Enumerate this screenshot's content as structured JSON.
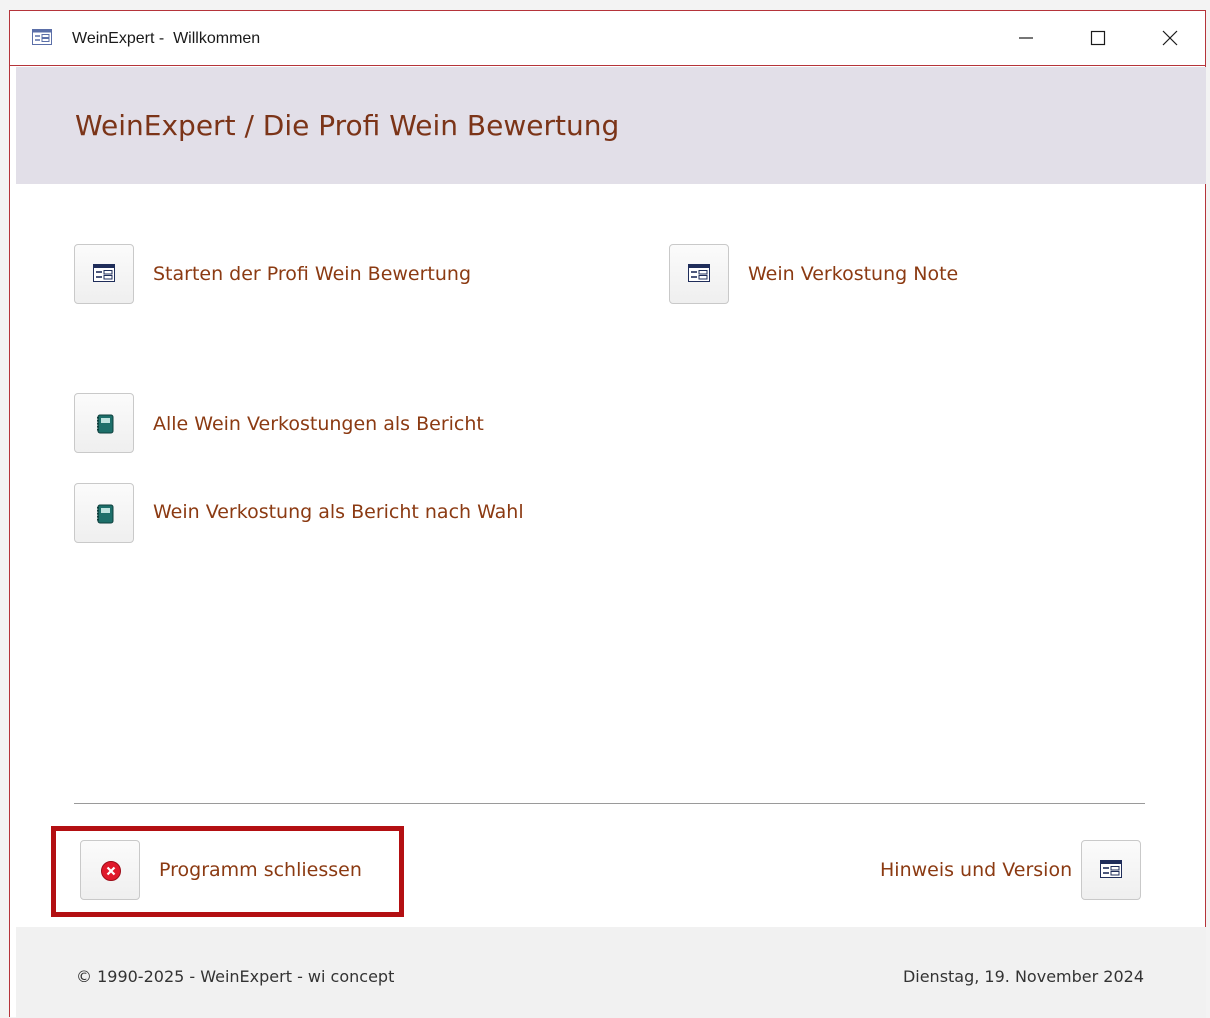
{
  "window": {
    "title": "WeinExpert -  Willkommen",
    "icon": "form-icon",
    "controls": [
      "minimize-icon",
      "maximize-icon",
      "close-icon"
    ]
  },
  "header": {
    "title": "WeinExpert / Die Profi Wein Bewertung"
  },
  "commands": {
    "start_rating": {
      "label": "Starten der Profi Wein Bewertung",
      "icon": "form-icon"
    },
    "tasting_note": {
      "label": "Wein Verkostung Note",
      "icon": "form-icon"
    },
    "all_reports": {
      "label": "Alle Wein Verkostungen als Bericht",
      "icon": "report-book-icon"
    },
    "report_choice": {
      "label": "Wein Verkostung als Bericht nach Wahl",
      "icon": "report-book-icon"
    },
    "close_program": {
      "label": "Programm schliessen",
      "icon": "close-circle-icon"
    },
    "info_version": {
      "label": "Hinweis und Version",
      "icon": "form-icon"
    }
  },
  "footer": {
    "copyright": "© 1990-2025 - WeinExpert - wi concept",
    "date": "Dienstag, 19. November 2024"
  },
  "colors": {
    "accent_text": "#8b3a12",
    "header_band": "#e2dfe8",
    "window_border": "#b5343a",
    "highlight_box": "#b30f12"
  }
}
